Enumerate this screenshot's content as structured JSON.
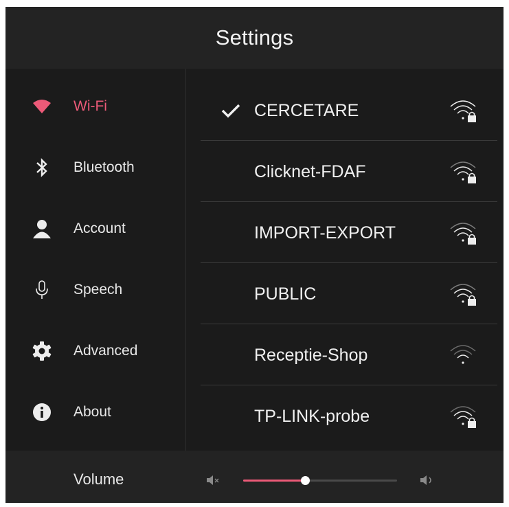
{
  "header": {
    "title": "Settings"
  },
  "sidebar": {
    "items": [
      {
        "label": "Wi-Fi",
        "icon": "wifi-icon",
        "active": true
      },
      {
        "label": "Bluetooth",
        "icon": "bluetooth-icon",
        "active": false
      },
      {
        "label": "Account",
        "icon": "account-icon",
        "active": false
      },
      {
        "label": "Speech",
        "icon": "microphone-icon",
        "active": false
      },
      {
        "label": "Advanced",
        "icon": "gear-icon",
        "active": false
      },
      {
        "label": "About",
        "icon": "info-icon",
        "active": false
      }
    ]
  },
  "networks": [
    {
      "name": "CERCETARE",
      "connected": true,
      "secured": true
    },
    {
      "name": "Clicknet-FDAF",
      "connected": false,
      "secured": true
    },
    {
      "name": "IMPORT-EXPORT",
      "connected": false,
      "secured": true
    },
    {
      "name": "PUBLIC",
      "connected": false,
      "secured": true
    },
    {
      "name": "Receptie-Shop",
      "connected": false,
      "secured": false
    },
    {
      "name": "TP-LINK-probe",
      "connected": false,
      "secured": true
    }
  ],
  "footer": {
    "volume_label": "Volume",
    "volume_level": 0.4,
    "mute_icon": "volume-mute-icon",
    "loud_icon": "volume-up-icon"
  },
  "colors": {
    "accent": "#ec5a78",
    "background": "#1b1b1b",
    "header_bg": "#232323",
    "text": "#f0f0f0"
  }
}
